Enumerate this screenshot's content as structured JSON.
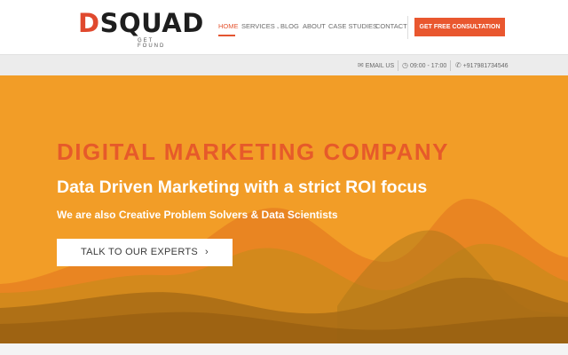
{
  "brand": {
    "logo_first": "D",
    "logo_rest": "SQUAD",
    "tagline": "GET FOUND",
    "accent_color": "#e9572f",
    "hero_color": "#f29d27"
  },
  "nav": {
    "items": [
      {
        "label": "HOME",
        "active": true
      },
      {
        "label": "SERVICES",
        "has_dropdown": true
      },
      {
        "label": "BLOG"
      },
      {
        "label": "ABOUT"
      },
      {
        "label": "CASE STUDIES"
      },
      {
        "label": "CONTACT"
      }
    ],
    "cta_label": "GET FREE CONSULTATION"
  },
  "infobar": {
    "email_label": "EMAIL US",
    "email_icon": "envelope-icon",
    "hours": "09:00 - 17:00",
    "hours_icon": "clock-icon",
    "phone": "+917981734546",
    "phone_icon": "phone-icon"
  },
  "hero": {
    "title": "DIGITAL MARKETING COMPANY",
    "subtitle": "Data Driven Marketing with a strict ROI focus",
    "tagline": "We are also Creative Problem Solvers & Data Scientists",
    "button_label": "TALK TO OUR EXPERTS",
    "button_icon": "chevron-right-icon"
  }
}
